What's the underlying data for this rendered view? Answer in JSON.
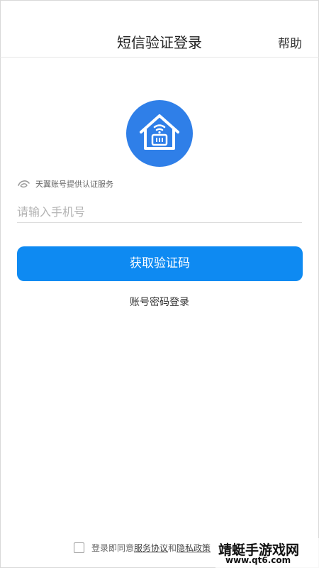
{
  "header": {
    "title": "短信验证登录",
    "help_label": "帮助"
  },
  "logo": {
    "icon": "smart-home-icon",
    "color": "#2f7fe8"
  },
  "provider": {
    "text": "天翼账号提供认证服务",
    "icon": "tianyi-logo-icon"
  },
  "phone_input": {
    "placeholder": "请输入手机号",
    "value": ""
  },
  "get_code_button": {
    "label": "获取验证码",
    "color": "#0e8af2"
  },
  "password_login_link": {
    "label": "账号密码登录"
  },
  "agreement": {
    "prefix": "登录即同意",
    "service_link": "服务协议",
    "and": "和",
    "privacy_link": "隐私政策",
    "checked": false
  },
  "watermark": {
    "title": "靖蜓手游戏网",
    "url": "www.qt6.com"
  }
}
